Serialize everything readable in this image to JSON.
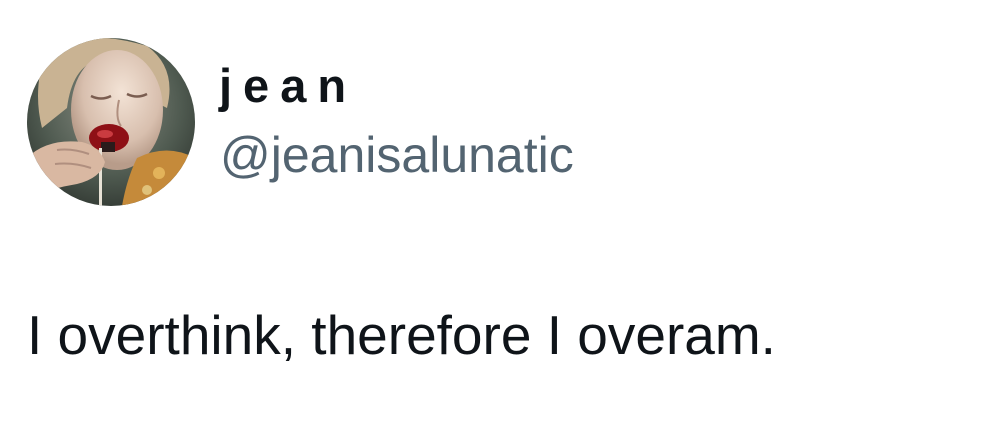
{
  "tweet": {
    "author": {
      "display_name": "jean",
      "handle": "@jeanisalunatic",
      "avatar_icon": "profile-photo"
    },
    "text": "I overthink, therefore I overam."
  },
  "colors": {
    "background": "#ffffff",
    "name_text": "#0f1419",
    "handle_text": "#536471",
    "body_text": "#0f1419"
  }
}
